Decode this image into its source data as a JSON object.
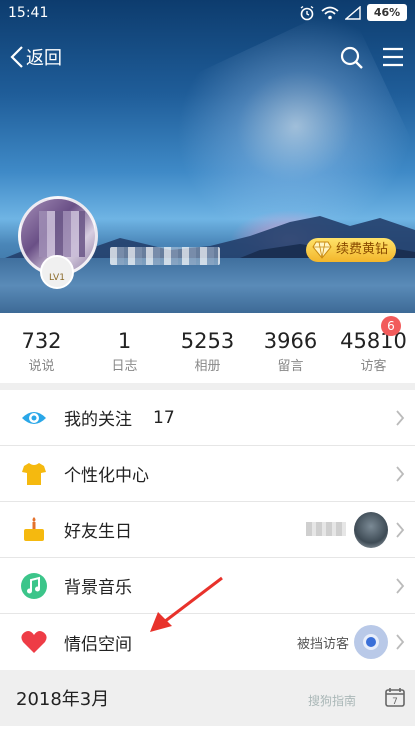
{
  "status_bar": {
    "time": "15:41",
    "battery": "46%",
    "icons": [
      "alarm-icon",
      "wifi-icon",
      "signal-icon",
      "battery-icon"
    ]
  },
  "nav": {
    "back_label": "返回",
    "icons": [
      "back-chevron-icon",
      "search-icon",
      "menu-icon"
    ]
  },
  "profile": {
    "level": "LV1",
    "vip_label": "续费黄钻"
  },
  "stats": [
    {
      "value": "732",
      "label": "说说"
    },
    {
      "value": "1",
      "label": "日志"
    },
    {
      "value": "5253",
      "label": "相册"
    },
    {
      "value": "3966",
      "label": "留言"
    },
    {
      "value": "45810",
      "label": "访客"
    }
  ],
  "visitor_badge": "6",
  "menu": [
    {
      "label": "我的关注",
      "count": "17",
      "icon": "eye-icon",
      "color": "#2aa7e8"
    },
    {
      "label": "个性化中心",
      "icon": "tshirt-icon",
      "color": "#f5b90f"
    },
    {
      "label": "好友生日",
      "icon": "cake-icon",
      "color": "#f5b90f"
    },
    {
      "label": "背景音乐",
      "icon": "music-icon",
      "color": "#3cc58a"
    },
    {
      "label": "情侣空间",
      "extra": "被挡访客",
      "icon": "heart-icon",
      "color": "#ee3c46"
    }
  ],
  "section": {
    "date": "2018年3月",
    "calendar_day": "7"
  },
  "watermark": "搜狗指南",
  "colors": {
    "accent_arrow": "#e8322b",
    "vip_gold": "#f3b62b",
    "badge_red": "#f25b5b"
  }
}
